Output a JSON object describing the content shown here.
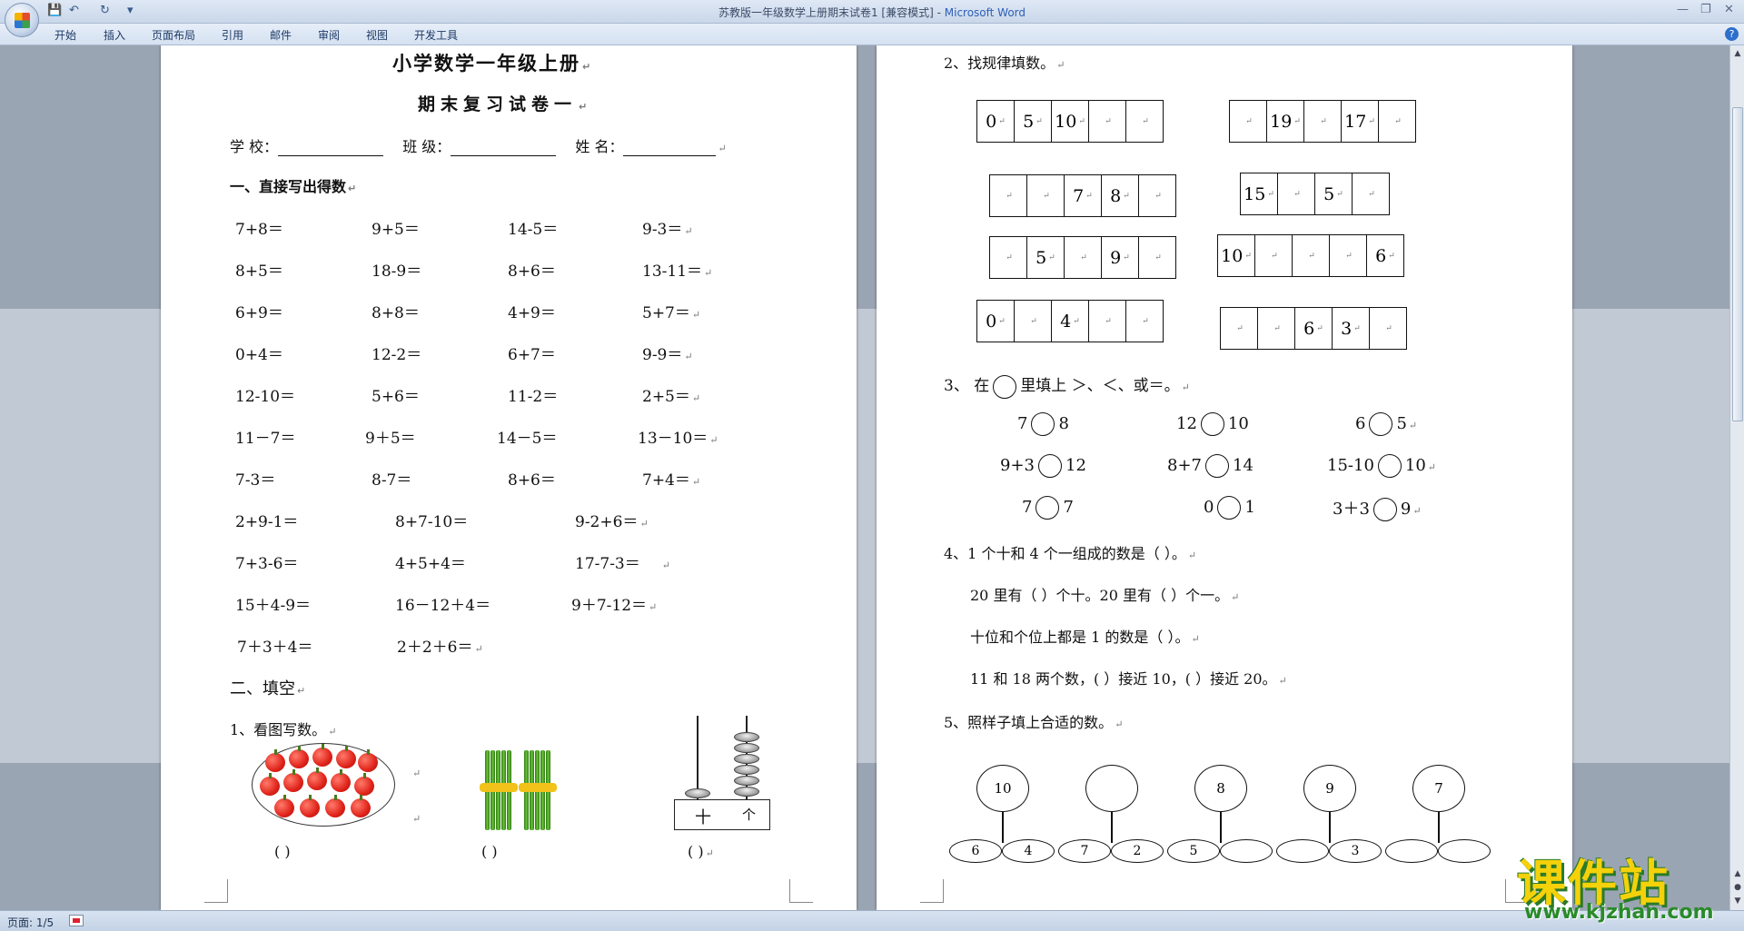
{
  "window": {
    "title": "苏教版一年级数学上册期末试卷1 [兼容模式] - ",
    "app_name": "Microsoft Word",
    "qat": [
      "💾",
      "↶",
      "↻",
      "▾"
    ],
    "controls": [
      "—",
      "❐",
      "✕"
    ]
  },
  "ribbon": {
    "tabs": [
      "开始",
      "插入",
      "页面布局",
      "引用",
      "邮件",
      "审阅",
      "视图",
      "开发工具"
    ],
    "help": "?"
  },
  "left_page": {
    "title": "小学数学一年级上册",
    "subtitle": "期末复习试卷一",
    "info": {
      "school": "学 校：",
      "class": "班 级：",
      "name": "姓 名："
    },
    "section1": "一、直接写出得数",
    "exercises": [
      [
        "7+8＝",
        "9+5＝",
        "14-5＝",
        "9-3＝"
      ],
      [
        "8+5＝",
        "18-9＝",
        "8+6＝",
        "13-11＝"
      ],
      [
        "6+9＝",
        "8+8＝",
        "4+9＝",
        "5+7＝"
      ],
      [
        "0+4＝",
        "12-2＝",
        "6+7＝",
        "9-9＝"
      ],
      [
        "12-10＝",
        "5+6＝",
        "11-2＝",
        "2+5＝"
      ],
      [
        "11－7＝",
        "9＋5＝",
        "14－5＝",
        "13－10＝"
      ],
      [
        "7-3＝",
        "8-7＝",
        "8+6＝",
        "7+4＝"
      ],
      [
        "2+9-1＝",
        "8+7-10＝",
        "9-2+6＝"
      ],
      [
        "7+3-6＝",
        "4+5+4＝",
        "17-7-3＝"
      ],
      [
        "15＋4-9＝",
        "16－12＋4＝",
        "9＋7-12＝"
      ],
      [
        "7＋3＋4＝",
        "2＋2＋6＝"
      ]
    ],
    "section2": "二、填空",
    "q1": "1、看图写数。",
    "answer_blanks": [
      "(          )",
      "(          )",
      "(          )"
    ],
    "abacus_labels": {
      "tens": "十",
      "ones": "个"
    }
  },
  "right_page": {
    "q2": "2、找规律填数。",
    "sequences": [
      [
        "0",
        "5",
        "10",
        "",
        ""
      ],
      [
        "",
        "19",
        "",
        "17",
        ""
      ],
      [
        "",
        "",
        "7",
        "8",
        ""
      ],
      [
        "15",
        "",
        "5",
        ""
      ],
      [
        "",
        "5",
        "",
        "9",
        ""
      ],
      [
        "10",
        "",
        "",
        "",
        "6"
      ],
      [
        "0",
        "",
        "4",
        "",
        ""
      ],
      [
        "",
        "",
        "6",
        "3",
        ""
      ]
    ],
    "q3_pre": "3、   在",
    "q3_post": "里填上 ＞、＜、或＝。",
    "comparisons": [
      [
        [
          "7",
          "8"
        ],
        [
          "12",
          "10"
        ],
        [
          "6",
          "5"
        ]
      ],
      [
        [
          "9+3",
          "12"
        ],
        [
          "8+7",
          "14"
        ],
        [
          "15-10",
          "10"
        ]
      ],
      [
        [
          "7",
          "7"
        ],
        [
          "0",
          "1"
        ],
        [
          "3＋3",
          "9"
        ]
      ]
    ],
    "q4": [
      "4、1 个十和 4 个一组成的数是（     ）。",
      "20 里有（     ）个十。20 里有（     ）个一。",
      "十位和个位上都是 1 的数是（     ）。",
      "11 和 18 两个数，(     ）接近 10，(     ）接近 20。"
    ],
    "q5": "5、照样子填上合适的数。",
    "trees": [
      {
        "top": "10",
        "left": "6",
        "right": "4"
      },
      {
        "top": "",
        "left": "7",
        "right": "2"
      },
      {
        "top": "8",
        "left": "5",
        "right": ""
      },
      {
        "top": "9",
        "left": "",
        "right": "3"
      },
      {
        "top": "7",
        "left": "",
        "right": ""
      }
    ]
  },
  "status": {
    "page": "页面: 1/5"
  },
  "watermark": {
    "main": "课件站",
    "url": "www.kjzhan.com"
  }
}
